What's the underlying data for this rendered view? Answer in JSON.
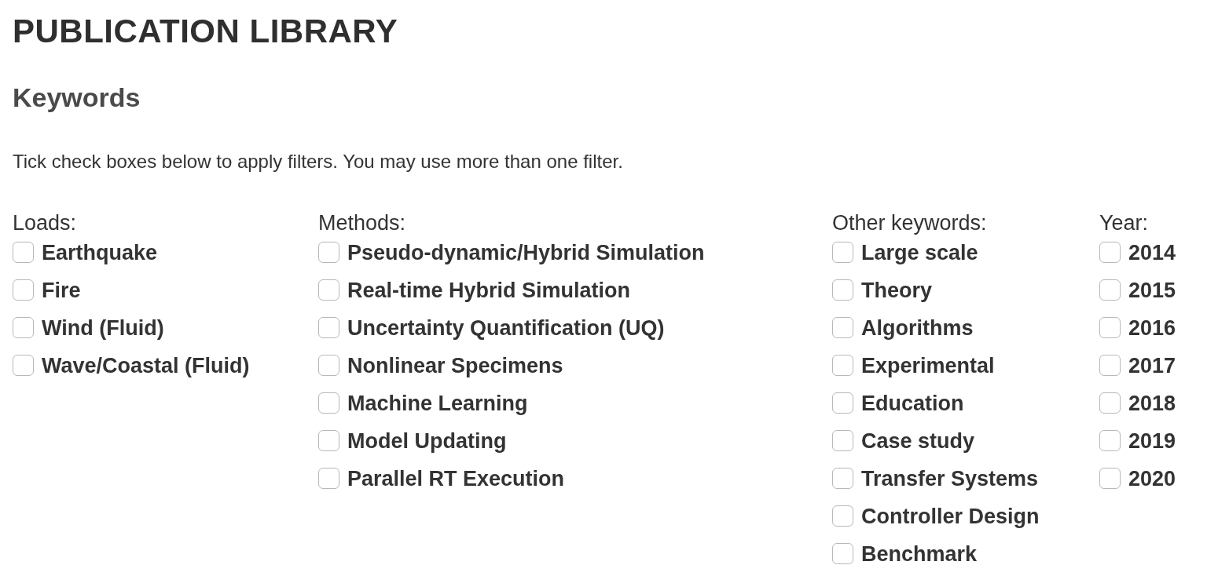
{
  "page": {
    "title": "PUBLICATION LIBRARY"
  },
  "section": {
    "heading": "Keywords",
    "instruction": "Tick check boxes below to apply filters. You may use more than one filter."
  },
  "groups": [
    {
      "label": "Loads:",
      "options": [
        {
          "label": "Earthquake",
          "checked": false
        },
        {
          "label": "Fire",
          "checked": false
        },
        {
          "label": "Wind (Fluid)",
          "checked": false
        },
        {
          "label": "Wave/Coastal (Fluid)",
          "checked": false
        }
      ]
    },
    {
      "label": "Methods:",
      "options": [
        {
          "label": "Pseudo-dynamic/Hybrid Simulation",
          "checked": false
        },
        {
          "label": "Real-time Hybrid Simulation",
          "checked": false
        },
        {
          "label": "Uncertainty Quantification (UQ)",
          "checked": false
        },
        {
          "label": "Nonlinear Specimens",
          "checked": false
        },
        {
          "label": "Machine Learning",
          "checked": false
        },
        {
          "label": "Model Updating",
          "checked": false
        },
        {
          "label": "Parallel RT Execution",
          "checked": false
        }
      ]
    },
    {
      "label": "Other keywords:",
      "options": [
        {
          "label": "Large scale",
          "checked": false
        },
        {
          "label": "Theory",
          "checked": false
        },
        {
          "label": "Algorithms",
          "checked": false
        },
        {
          "label": "Experimental",
          "checked": false
        },
        {
          "label": "Education",
          "checked": false
        },
        {
          "label": "Case study",
          "checked": false
        },
        {
          "label": "Transfer Systems",
          "checked": false
        },
        {
          "label": "Controller Design",
          "checked": false
        },
        {
          "label": "Benchmark",
          "checked": false
        }
      ]
    },
    {
      "label": "Year:",
      "options": [
        {
          "label": "2014",
          "checked": false
        },
        {
          "label": "2015",
          "checked": false
        },
        {
          "label": "2016",
          "checked": false
        },
        {
          "label": "2017",
          "checked": false
        },
        {
          "label": "2018",
          "checked": false
        },
        {
          "label": "2019",
          "checked": false
        },
        {
          "label": "2020",
          "checked": false
        }
      ]
    }
  ]
}
